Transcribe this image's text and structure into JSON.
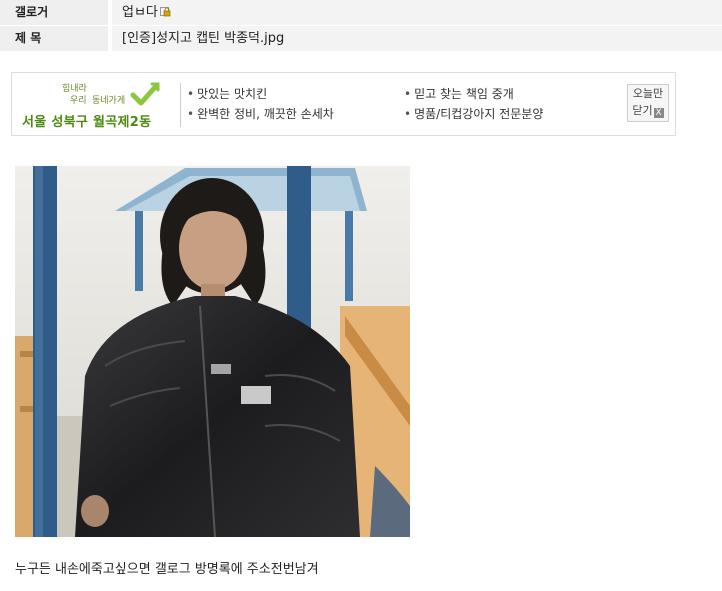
{
  "post": {
    "author_label": "갤로거",
    "author_name": "업ㅂ다",
    "title_label": "제 목",
    "title_value": "[인증]성지고 캡틴 박종덕.jpg"
  },
  "ad": {
    "slogan_1": "힘내라",
    "slogan_2": "우리",
    "slogan_3": "동네가게",
    "region": "서울 성북구 월곡제2동",
    "items": [
      "맛있는 맛치킨",
      "믿고 찾는 책임 중개",
      "완벽한 정비, 깨끗한 손세차",
      "명품/티컵강아지 전문분양"
    ],
    "close_line1": "오늘만",
    "close_line2": "닫기",
    "close_x": "X"
  },
  "content": {
    "caption": "누구든 내손에죽고싶으면 갤로그 방명록에 주소전번남겨"
  },
  "colors": {
    "label_bg": "#efefef",
    "value_bg": "#f3f3f3",
    "ad_green": "#4c8a12",
    "check_green": "#8cc63f"
  },
  "icons": [
    "lock-icon",
    "check-icon",
    "close-x-icon"
  ]
}
